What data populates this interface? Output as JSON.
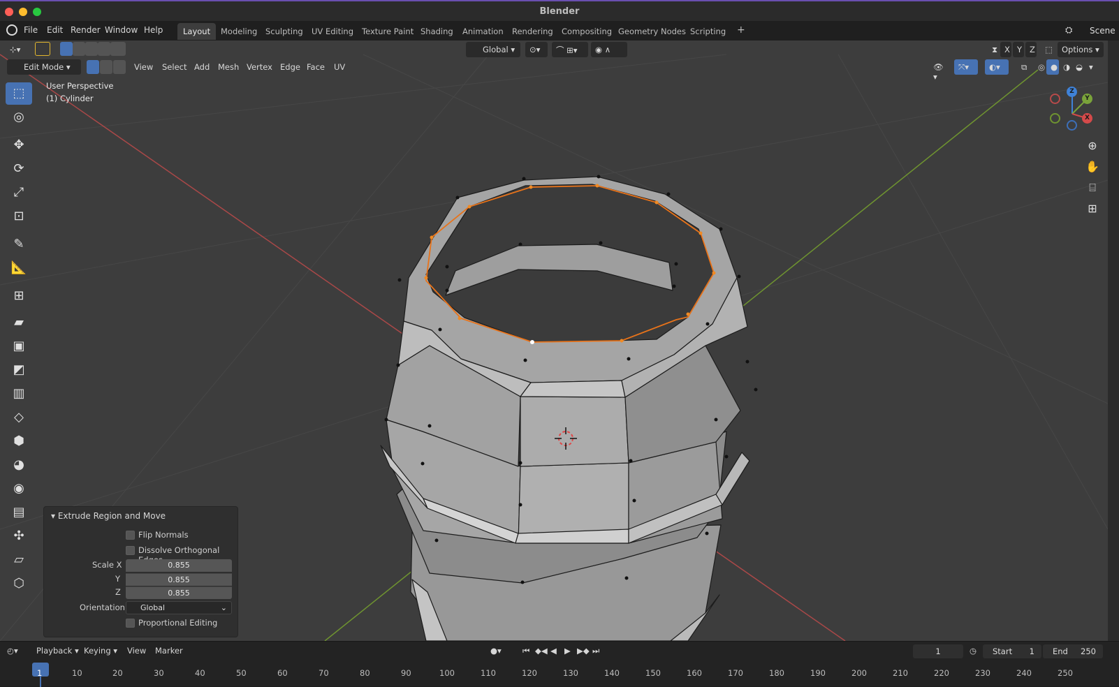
{
  "window": {
    "title": "Blender"
  },
  "menu": [
    "File",
    "Edit",
    "Render",
    "Window",
    "Help"
  ],
  "workspaces": [
    "Layout",
    "Modeling",
    "Sculpting",
    "UV Editing",
    "Texture Paint",
    "Shading",
    "Animation",
    "Rendering",
    "Compositing",
    "Geometry Nodes",
    "Scripting"
  ],
  "add_workspace": "+",
  "scene": "Scene",
  "header": {
    "orientation": "Global",
    "axes": [
      "X",
      "Y",
      "Z"
    ],
    "options": "Options"
  },
  "viewport_header": {
    "mode": "Edit Mode",
    "menus": [
      "View",
      "Select",
      "Add",
      "Mesh",
      "Vertex",
      "Edge",
      "Face",
      "UV"
    ]
  },
  "overlay": {
    "perspective": "User Perspective",
    "object": "(1) Cylinder"
  },
  "gizmo_axes": {
    "x": "X",
    "y": "Y",
    "z": "Z"
  },
  "operator_panel": {
    "title": "Extrude Region and Move",
    "flip_normals": "Flip Normals",
    "dissolve": "Dissolve Orthogonal Edges",
    "scale_x_label": "Scale X",
    "scale_y_label": "Y",
    "scale_z_label": "Z",
    "scale_x": "0.855",
    "scale_y": "0.855",
    "scale_z": "0.855",
    "orientation_label": "Orientation",
    "orientation": "Global",
    "proportional": "Proportional Editing"
  },
  "timeline": {
    "menus": [
      "Playback",
      "Keying",
      "View",
      "Marker"
    ],
    "current_frame": "1",
    "start_label": "Start",
    "start": "1",
    "end_label": "End",
    "end": "250",
    "ticks": [
      "1",
      "10",
      "20",
      "30",
      "40",
      "50",
      "60",
      "70",
      "80",
      "90",
      "100",
      "110",
      "120",
      "130",
      "140",
      "150",
      "160",
      "170",
      "180",
      "190",
      "200",
      "210",
      "220",
      "230",
      "240",
      "250"
    ]
  },
  "colors": {
    "accent": "#4772b3",
    "selected_edge": "#e8731a",
    "axis_x": "#d44a4a",
    "axis_y": "#7aa33a",
    "axis_z": "#3f82d8"
  }
}
